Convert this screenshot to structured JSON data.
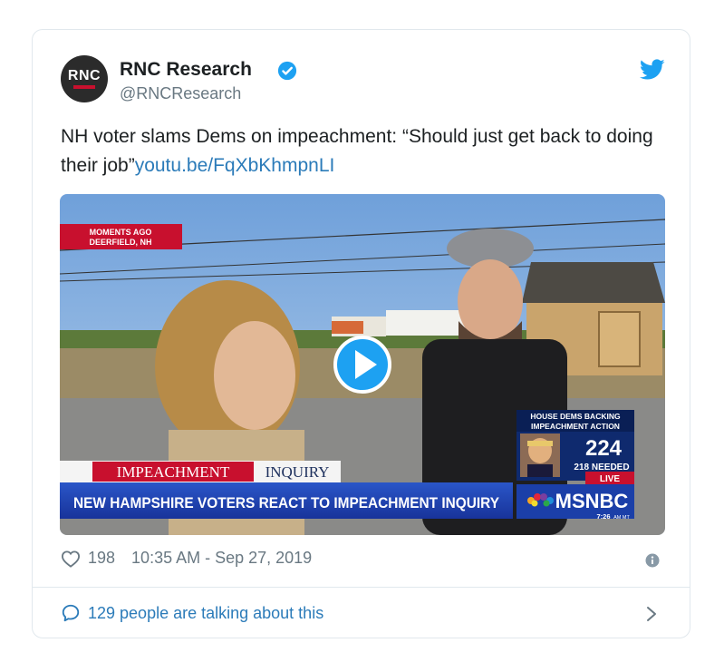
{
  "account": {
    "avatar_text": "RNC",
    "display_name": "RNC Research",
    "handle": "@RNCResearch"
  },
  "icons": {
    "verified": "verified-badge-icon",
    "brand": "twitter-bird-icon",
    "like": "heart-icon",
    "info": "info-icon",
    "reply": "speech-bubble-icon",
    "more": "chevron-right-icon"
  },
  "tweet": {
    "text": "NH voter slams Dems on impeachment: “Should just get back to doing their job”",
    "link": "youtu.be/FqXbKhmpnLI"
  },
  "media": {
    "top_tag_line1": "MOMENTS AGO",
    "top_tag_line2": "DEERFIELD, NH",
    "banner_red": "IMPEACHMENT",
    "banner_white": "INQUIRY",
    "headline": "NEW HAMPSHIRE VOTERS REACT TO IMPEACHMENT INQUIRY",
    "box_line1": "HOUSE DEMS BACKING",
    "box_line2": "IMPEACHMENT ACTION",
    "box_count": "224",
    "box_needed": "218 NEEDED",
    "live_label": "LIVE",
    "network": "MSNBC",
    "clock": "7:26",
    "clock_suffix": "AM MT"
  },
  "footer": {
    "likes": "198",
    "timestamp": "10:35 AM - Sep 27, 2019",
    "talking": "129 people are talking about this"
  },
  "colors": {
    "link": "#2b7bb9",
    "muted": "#697882",
    "verified": "#1da1f2",
    "msnbc_blue": "#1b3fa8",
    "banner_red": "#c8102e"
  }
}
